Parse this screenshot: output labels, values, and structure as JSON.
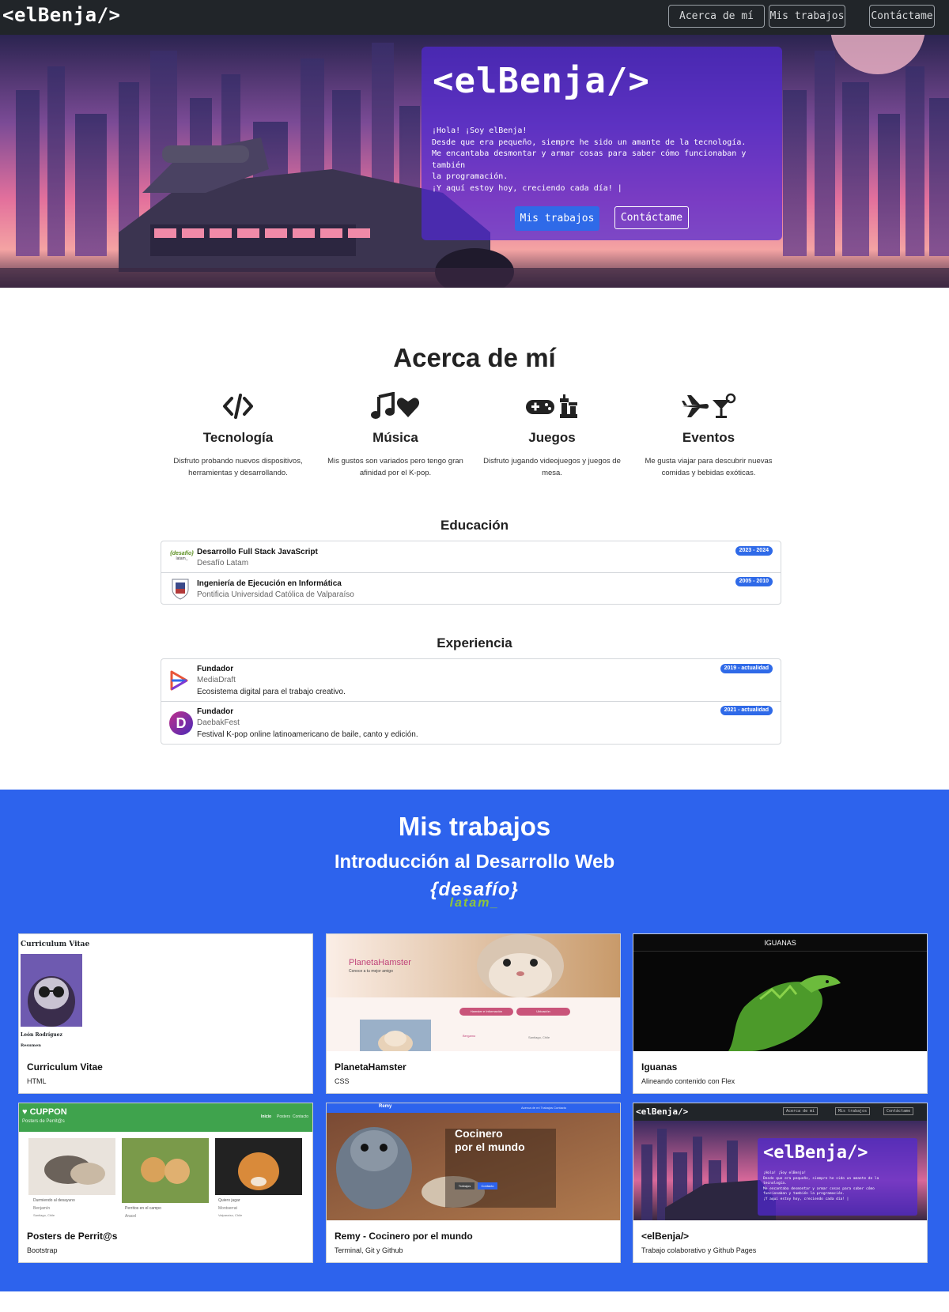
{
  "nav": {
    "brand": "<elBenja/>",
    "links": [
      "Acerca de mí",
      "Mis trabajos",
      "Contáctame"
    ]
  },
  "hero": {
    "title": "<elBenja/>",
    "lines": [
      "¡Hola! ¡Soy elBenja!",
      "Desde que era pequeño, siempre he sido un amante de la tecnología.",
      "Me encantaba desmontar y armar cosas para saber cómo funcionaban y también",
      "la programación.",
      "¡Y aquí estoy hoy, creciendo cada día! |"
    ],
    "primary_button": "Mis trabajos",
    "secondary_button": "Contáctame"
  },
  "about": {
    "title": "Acerca de mí",
    "interests": [
      {
        "icon": "code-icon",
        "title": "Tecnología",
        "desc": "Disfruto probando nuevos dispositivos, herramientas y desarrollando."
      },
      {
        "icon": "music-heart-icon",
        "title": "Música",
        "desc": "Mis gustos son variados pero tengo gran afinidad por el K-pop."
      },
      {
        "icon": "gamepad-chess-icon",
        "title": "Juegos",
        "desc": "Disfruto jugando videojuegos y juegos de mesa."
      },
      {
        "icon": "plane-cocktail-icon",
        "title": "Eventos",
        "desc": "Me gusta viajar para descubrir nuevas comidas y bebidas exóticas."
      }
    ]
  },
  "education": {
    "title": "Educación",
    "items": [
      {
        "title": "Desarrollo Full Stack JavaScript",
        "institution": "Desafío Latam",
        "period": "2023 - 2024",
        "logo_text": "{desafío}",
        "logo_sub": "latam_"
      },
      {
        "title": "Ingeniería de Ejecución en Informática",
        "institution": "Pontificia Universidad Católica de Valparaíso",
        "period": "2005 - 2010"
      }
    ]
  },
  "experience": {
    "title": "Experiencia",
    "items": [
      {
        "title": "Fundador",
        "company": "MediaDraft",
        "desc": "Ecosistema digital para el trabajo creativo.",
        "period": "2019 - actualidad"
      },
      {
        "title": "Fundador",
        "company": "DaebakFest",
        "desc": "Festival K-pop online latinoamericano de baile, canto y edición.",
        "period": "2021 - actualidad",
        "logo_letter": "D"
      }
    ]
  },
  "works": {
    "title": "Mis trabajos",
    "subtitle": "Introducción al Desarrollo Web",
    "logo_main": "{desafío}",
    "logo_sub": "latam_",
    "projects": [
      {
        "title": "Curriculum Vitae",
        "tech": "HTML",
        "thumb_title": "Curriculum Vitae",
        "thumb_name": "León Rodríguez",
        "thumb_section": "Resumen"
      },
      {
        "title": "PlanetaHamster",
        "tech": "CSS",
        "thumb_title": "PlanetaHamster",
        "thumb_tagline": "Conoce a tu mejor amigo",
        "thumb_btn1": "Hamster e Información",
        "thumb_btn2": "Ubicación",
        "thumb_col1": "Bergamo",
        "thumb_col2": "Santiago, Chile"
      },
      {
        "title": "Iguanas",
        "tech": "Alineando contenido con Flex",
        "thumb_title": "IGUANAS"
      },
      {
        "title": "Posters de Perrit@s",
        "tech": "Bootstrap",
        "thumb_brand": "CUPPON",
        "thumb_sub": "Posters de Perrit@s",
        "thumb_nav": [
          "Inicio",
          "Posters",
          "Contacto"
        ],
        "thumb_captions": [
          "Durmiendo al desayuno",
          "Perritos en el campo",
          "Quiero jugar"
        ],
        "thumb_names": [
          "Benjamín",
          "Aracel",
          "Montserrat"
        ],
        "thumb_places": [
          "Santiago, Chile",
          "",
          "Valparaíso, Chile"
        ]
      },
      {
        "title": "Remy - Cocinero por el mundo",
        "tech": "Terminal, Git y Github",
        "thumb_brand": "Remy",
        "thumb_nav": "Acerca de mí   Trabajos   Contacto",
        "thumb_heading1": "Cocinero",
        "thumb_heading2": "por el mundo",
        "thumb_btn1": "Trabajos",
        "thumb_btn2": "Contacto"
      },
      {
        "title": "<elBenja/>",
        "tech": "Trabajo colaborativo y Github Pages",
        "thumb_brand": "<elBenja/>",
        "thumb_nav": [
          "Acerca de mí",
          "Mis trabajos",
          "Contáctame"
        ],
        "thumb_title": "<elBenja/>",
        "thumb_lines": [
          "¡Hola! ¡Soy elBenja!",
          "Desde que era pequeño, siempre he sido un amante de la",
          "tecnología.",
          "Me encantaba desmontar y armar cosas para saber cómo",
          "funcionaban y también la programación.",
          "¡Y aquí estoy hoy, creciendo cada día! |"
        ]
      }
    ]
  },
  "colors": {
    "navbar": "#212529",
    "accent": "#2f6ae8",
    "works_bg": "#2d63ed",
    "hero_card": "#5028d2"
  }
}
